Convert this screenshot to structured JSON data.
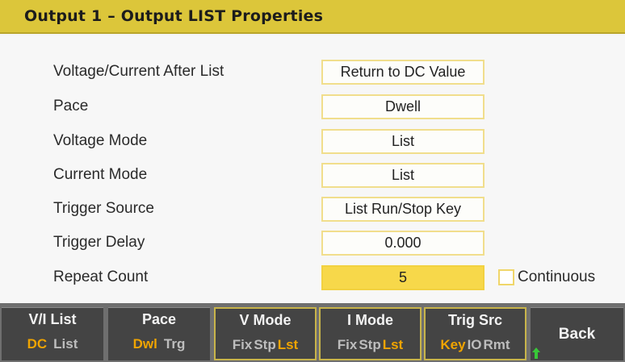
{
  "header": {
    "title": "Output 1 – Output LIST Properties"
  },
  "properties": [
    {
      "label": "Voltage/Current After List",
      "value": "Return to DC Value"
    },
    {
      "label": "Pace",
      "value": "Dwell"
    },
    {
      "label": "Voltage Mode",
      "value": "List"
    },
    {
      "label": "Current Mode",
      "value": "List"
    },
    {
      "label": "Trigger Source",
      "value": "List Run/Stop Key"
    },
    {
      "label": "Trigger Delay",
      "value": "0.000"
    },
    {
      "label": "Repeat Count",
      "value": "5"
    }
  ],
  "continuous": {
    "label": "Continuous",
    "checked": false
  },
  "softkeys": [
    {
      "label": "V/I List",
      "options": [
        "DC",
        "List"
      ],
      "selected": 0
    },
    {
      "label": "Pace",
      "options": [
        "Dwl",
        "Trg"
      ],
      "selected": 0
    },
    {
      "label": "V Mode",
      "options": [
        "Fix",
        "Stp",
        "Lst"
      ],
      "selected": 2
    },
    {
      "label": "I Mode",
      "options": [
        "Fix",
        "Stp",
        "Lst"
      ],
      "selected": 2
    },
    {
      "label": "Trig Src",
      "options": [
        "Key",
        "IO",
        "Rmt"
      ],
      "selected": 0
    },
    {
      "label": "Back"
    }
  ],
  "colors": {
    "title_bar": "#dcc63a",
    "selected_option": "#f0a400",
    "active_field": "#f7d84a"
  }
}
